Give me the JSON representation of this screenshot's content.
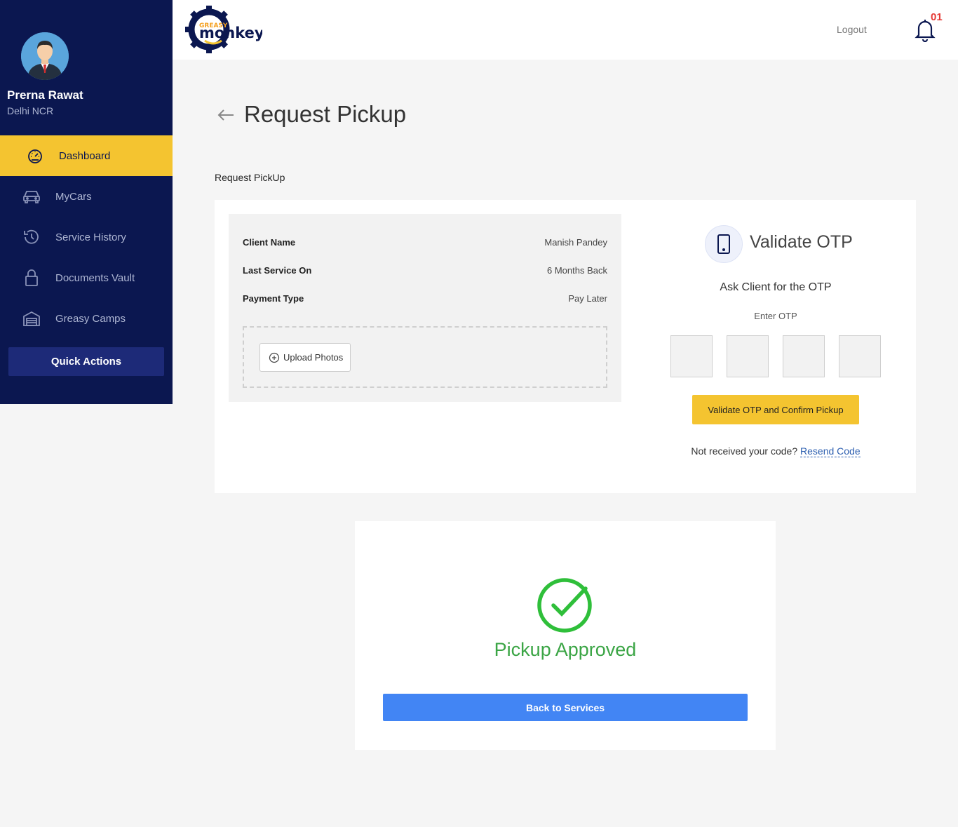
{
  "sidebar": {
    "profile": {
      "name": "Prerna Rawat",
      "location": "Delhi NCR"
    },
    "items": [
      {
        "label": "Dashboard",
        "icon": "speedometer-icon",
        "active": true
      },
      {
        "label": "MyCars",
        "icon": "car-icon",
        "active": false
      },
      {
        "label": "Service History",
        "icon": "history-icon",
        "active": false
      },
      {
        "label": "Documents Vault",
        "icon": "lock-icon",
        "active": false
      },
      {
        "label": "Greasy Camps",
        "icon": "garage-icon",
        "active": false
      }
    ],
    "quick_actions_label": "Quick Actions"
  },
  "header": {
    "logo_text_top": "GREASY",
    "logo_text_main": "monkey",
    "logout_label": "Logout",
    "notification_count": "01"
  },
  "page": {
    "title": "Request Pickup",
    "section_label": "Request PickUp"
  },
  "client_info": {
    "rows": [
      {
        "label": "Client Name",
        "value": "Manish Pandey"
      },
      {
        "label": "Last Service On",
        "value": "6 Months Back"
      },
      {
        "label": "Payment Type",
        "value": "Pay Later"
      }
    ],
    "upload_label": "Upload Photos"
  },
  "otp": {
    "title": "Validate OTP",
    "ask": "Ask Client for the OTP",
    "enter_label": "Enter OTP",
    "digits": [
      "",
      "",
      "",
      ""
    ],
    "validate_button": "Validate OTP and Confirm Pickup",
    "resend_prompt": "Not received your code?",
    "resend_link": "Resend Code"
  },
  "success": {
    "message": "Pickup Approved",
    "back_button": "Back to Services"
  },
  "colors": {
    "sidebar_bg": "#0b1750",
    "accent_yellow": "#f4c430",
    "success_green": "#3ba545",
    "primary_blue": "#4285f4",
    "badge_red": "#e53935"
  }
}
